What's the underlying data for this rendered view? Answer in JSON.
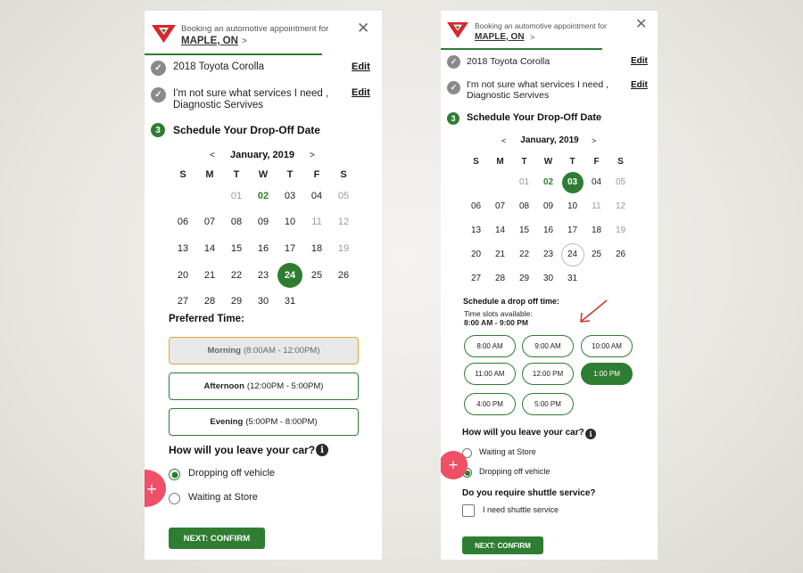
{
  "header": {
    "booking_text": "Booking an automotive appointment for",
    "location": "MAPLE, ON",
    "location_chevron": ">",
    "close_label": "✕"
  },
  "summary": {
    "vehicle": "2018 Toyota Corolla",
    "services": "I'm not sure what services I need , Diagnostic Servives",
    "edit_label": "Edit"
  },
  "step": {
    "number": "3",
    "title": "Schedule Your Drop-Off Date"
  },
  "calendar": {
    "month_label": "January, 2019",
    "prev": "<",
    "next": ">",
    "weekdays": [
      "S",
      "M",
      "T",
      "W",
      "T",
      "F",
      "S"
    ],
    "weeks": [
      [
        "",
        "",
        "01",
        "02",
        "03",
        "04",
        "05"
      ],
      [
        "06",
        "07",
        "08",
        "09",
        "10",
        "11",
        "12"
      ],
      [
        "13",
        "14",
        "15",
        "16",
        "17",
        "18",
        "19"
      ],
      [
        "20",
        "21",
        "22",
        "23",
        "24",
        "25",
        "26"
      ],
      [
        "27",
        "28",
        "29",
        "30",
        "31",
        "",
        ""
      ]
    ],
    "left_selected": "24",
    "right_selected": "03",
    "today": "02",
    "muted": [
      "01",
      "05",
      "11",
      "12",
      "19"
    ]
  },
  "preferred_time": {
    "label": "Preferred Time:",
    "options": [
      {
        "name": "Morning",
        "range": "(8:00AM - 12:00PM)",
        "active": true
      },
      {
        "name": "Afternoon",
        "range": "(12:00PM - 5:00PM)",
        "active": false
      },
      {
        "name": "Evening",
        "range": "(5:00PM - 8:00PM)",
        "active": false
      }
    ]
  },
  "drop_off_time": {
    "label": "Schedule a drop off time:",
    "available_label": "Time slots available:",
    "available_range": "8:00 AM - 9:00 PM",
    "slots": [
      "8:00 AM",
      "9:00 AM",
      "10:00 AM",
      "11:00 AM",
      "12:00 PM",
      "1:00 PM",
      "4:00 PM",
      "5:00 PM"
    ],
    "selected_slot": "1:00 PM"
  },
  "leave_car": {
    "question": "How will you leave your car?",
    "info_icon": "i",
    "left_options": [
      {
        "label": "Dropping off vehicle",
        "checked": true
      },
      {
        "label": "Waiting at Store",
        "checked": false
      }
    ],
    "right_options": [
      {
        "label": "Waiting at Store",
        "checked": false
      },
      {
        "label": "Dropping off vehicle",
        "checked": true
      }
    ]
  },
  "shuttle": {
    "question": "Do you require shuttle service?",
    "option": "I need shuttle service"
  },
  "fab_label": "+",
  "confirm_label": "NEXT: CONFIRM",
  "colors": {
    "brand_green": "#2e7d32",
    "fab_pink": "#ef4f67",
    "logo_red": "#d7262d"
  }
}
